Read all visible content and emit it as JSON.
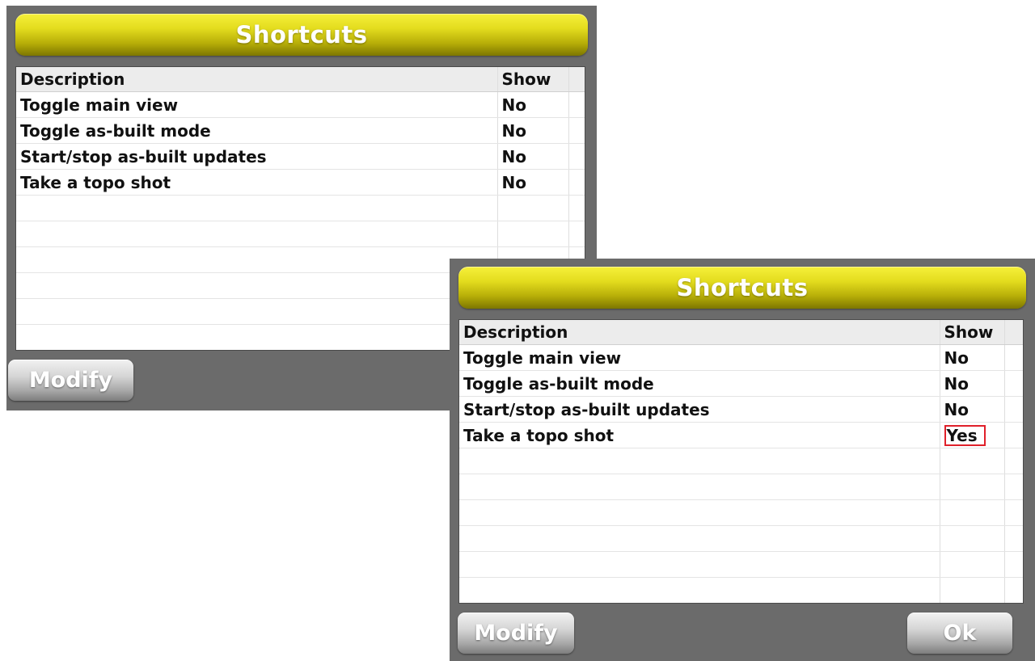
{
  "panels": [
    {
      "title": "Shortcuts",
      "columns": [
        "Description",
        "Show"
      ],
      "rows": [
        {
          "description": "Toggle main view",
          "show": "No"
        },
        {
          "description": "Toggle as-built mode",
          "show": "No"
        },
        {
          "description": "Start/stop as-built updates",
          "show": "No"
        },
        {
          "description": "Take a topo shot",
          "show": "No"
        }
      ],
      "modify_label": "Modify"
    },
    {
      "title": "Shortcuts",
      "columns": [
        "Description",
        "Show"
      ],
      "rows": [
        {
          "description": "Toggle main view",
          "show": "No"
        },
        {
          "description": "Toggle as-built mode",
          "show": "No"
        },
        {
          "description": "Start/stop as-built updates",
          "show": "No"
        },
        {
          "description": "Take a topo shot",
          "show": "Yes"
        }
      ],
      "modify_label": "Modify",
      "ok_label": "Ok"
    }
  ],
  "colors": {
    "title_bar": "#e3dc1e",
    "panel_bg": "#6b6b6b",
    "highlight_box": "#e0202a"
  }
}
